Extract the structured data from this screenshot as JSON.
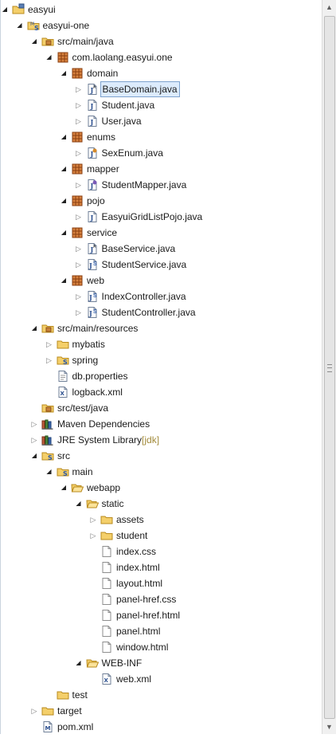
{
  "tree": [
    {
      "label": "easyui",
      "icon": "project-folder-icon",
      "toggle": "open"
    },
    {
      "label": "easyui-one",
      "icon": "maven-project-icon",
      "toggle": "open"
    },
    {
      "label": "src/main/java",
      "icon": "source-folder-icon",
      "toggle": "open"
    },
    {
      "label": "com.laolang.easyui.one",
      "icon": "package-icon",
      "toggle": "open"
    },
    {
      "label": "domain",
      "icon": "package-icon",
      "toggle": "open"
    },
    {
      "label": "BaseDomain.java",
      "icon": "java-abstract-icon",
      "toggle": "closed",
      "selected": true
    },
    {
      "label": "Student.java",
      "icon": "java-file-icon",
      "toggle": "closed"
    },
    {
      "label": "User.java",
      "icon": "java-file-icon",
      "toggle": "closed"
    },
    {
      "label": "enums",
      "icon": "package-icon",
      "toggle": "open"
    },
    {
      "label": "SexEnum.java",
      "icon": "java-enum-icon",
      "toggle": "closed"
    },
    {
      "label": "mapper",
      "icon": "package-icon",
      "toggle": "open"
    },
    {
      "label": "StudentMapper.java",
      "icon": "java-interface-icon",
      "toggle": "closed"
    },
    {
      "label": "pojo",
      "icon": "package-icon",
      "toggle": "open"
    },
    {
      "label": "EasyuiGridListPojo.java",
      "icon": "java-file-icon",
      "toggle": "closed"
    },
    {
      "label": "service",
      "icon": "package-icon",
      "toggle": "open"
    },
    {
      "label": "BaseService.java",
      "icon": "java-abstract-icon",
      "toggle": "closed"
    },
    {
      "label": "StudentService.java",
      "icon": "java-spring-icon",
      "toggle": "closed"
    },
    {
      "label": "web",
      "icon": "package-icon",
      "toggle": "open"
    },
    {
      "label": "IndexController.java",
      "icon": "java-spring-icon",
      "toggle": "closed"
    },
    {
      "label": "StudentController.java",
      "icon": "java-spring-icon",
      "toggle": "closed"
    },
    {
      "label": "src/main/resources",
      "icon": "source-folder-icon",
      "toggle": "open"
    },
    {
      "label": "mybatis",
      "icon": "folder-icon",
      "toggle": "closed"
    },
    {
      "label": "spring",
      "icon": "spring-folder-icon",
      "toggle": "closed"
    },
    {
      "label": "db.properties",
      "icon": "properties-file-icon",
      "toggle": "none"
    },
    {
      "label": "logback.xml",
      "icon": "xml-file-icon",
      "toggle": "none"
    },
    {
      "label": "src/test/java",
      "icon": "source-folder-icon",
      "toggle": "none"
    },
    {
      "label": "Maven Dependencies",
      "icon": "library-icon",
      "toggle": "closed"
    },
    {
      "label": "JRE System Library",
      "decoration": "[jdk]",
      "icon": "library-icon",
      "toggle": "closed"
    },
    {
      "label": "src",
      "icon": "spring-folder-icon",
      "toggle": "open"
    },
    {
      "label": "main",
      "icon": "spring-folder-icon",
      "toggle": "open"
    },
    {
      "label": "webapp",
      "icon": "folder-open-icon",
      "toggle": "open"
    },
    {
      "label": "static",
      "icon": "folder-open-icon",
      "toggle": "open"
    },
    {
      "label": "assets",
      "icon": "folder-icon",
      "toggle": "closed"
    },
    {
      "label": "student",
      "icon": "folder-icon",
      "toggle": "closed"
    },
    {
      "label": "index.css",
      "icon": "text-file-icon",
      "toggle": "none"
    },
    {
      "label": "index.html",
      "icon": "text-file-icon",
      "toggle": "none"
    },
    {
      "label": "layout.html",
      "icon": "text-file-icon",
      "toggle": "none"
    },
    {
      "label": "panel-href.css",
      "icon": "text-file-icon",
      "toggle": "none"
    },
    {
      "label": "panel-href.html",
      "icon": "text-file-icon",
      "toggle": "none"
    },
    {
      "label": "panel.html",
      "icon": "text-file-icon",
      "toggle": "none"
    },
    {
      "label": "window.html",
      "icon": "text-file-icon",
      "toggle": "none"
    },
    {
      "label": "WEB-INF",
      "icon": "folder-open-icon",
      "toggle": "open"
    },
    {
      "label": "web.xml",
      "icon": "xml-file-icon",
      "toggle": "none"
    },
    {
      "label": "test",
      "icon": "folder-icon",
      "toggle": "none"
    },
    {
      "label": "target",
      "icon": "folder-icon",
      "toggle": "closed"
    },
    {
      "label": "pom.xml",
      "icon": "maven-pom-icon",
      "toggle": "none"
    }
  ],
  "colors": {
    "selection_bg": "#dcebfc",
    "selection_border": "#7da2ce",
    "package": "#a0522d",
    "folder": "#e8b84a",
    "decoration": "#a28a3a"
  }
}
